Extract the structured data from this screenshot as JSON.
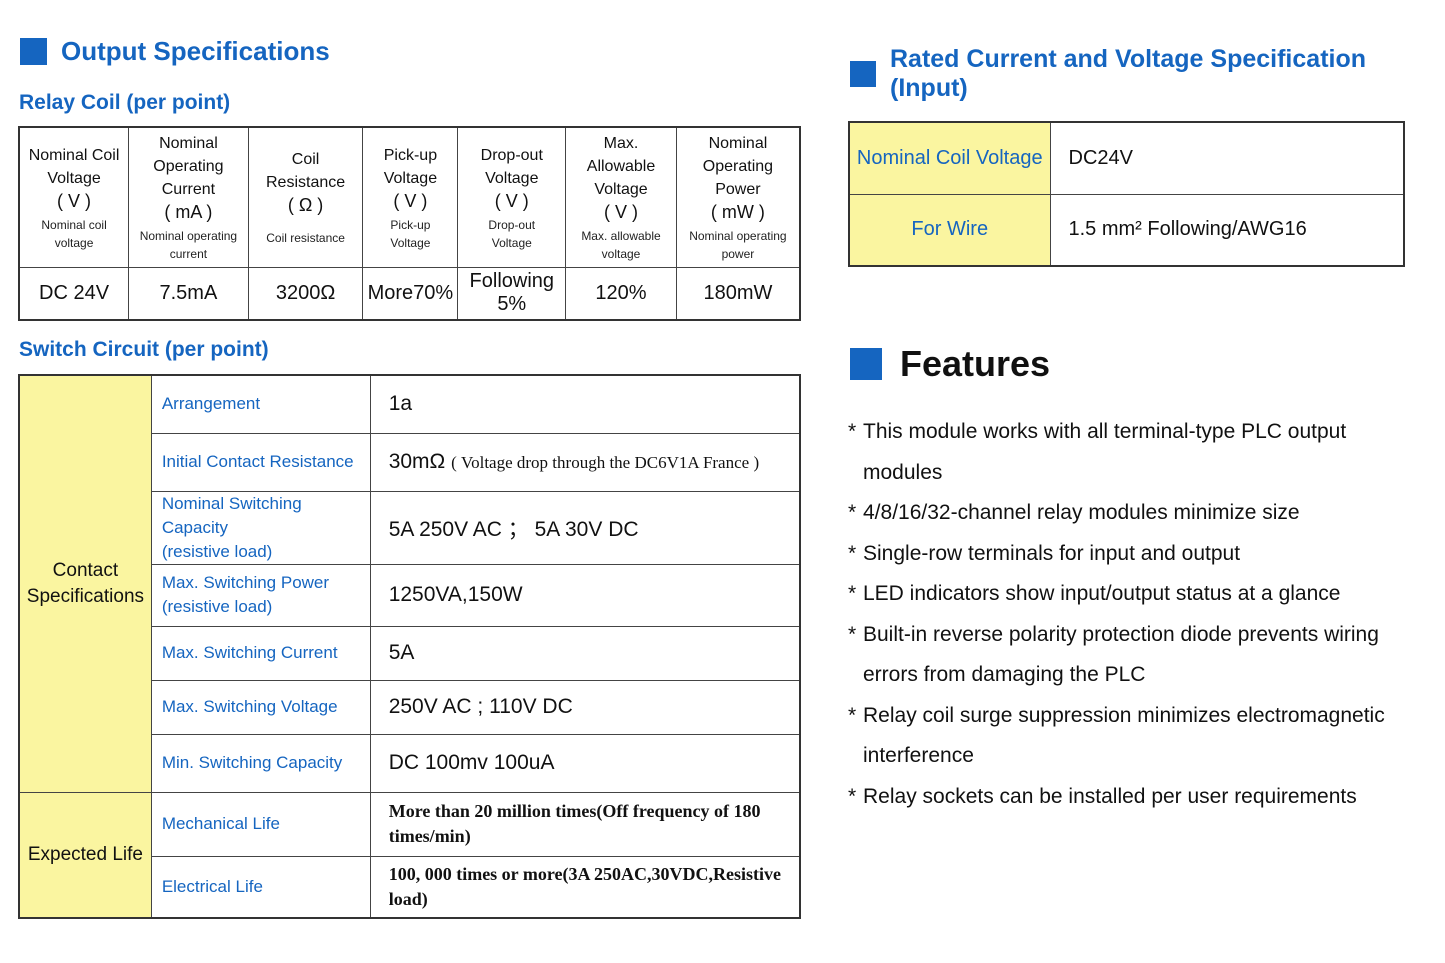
{
  "output_specs": {
    "title": "Output Specifications"
  },
  "relay_coil": {
    "title": "Relay Coil (per point)",
    "columns": [
      {
        "main1": "Nominal Coil",
        "main2": "Voltage",
        "unit": "( V )",
        "sub1": "Nominal coil",
        "sub2": "voltage",
        "value": "DC 24V"
      },
      {
        "main1": "Nominal Operating",
        "main2": "Current",
        "unit": "( mA )",
        "sub1": "Nominal operating",
        "sub2": "current",
        "value": "7.5mA"
      },
      {
        "main1": "Coil Resistance",
        "main2": "",
        "unit": "( Ω )",
        "sub1": "Coil resistance",
        "sub2": "",
        "value": "3200Ω"
      },
      {
        "main1": "Pick-up",
        "main2": "Voltage",
        "unit": "( V )",
        "sub1": "Pick-up",
        "sub2": "Voltage",
        "value": "More70%"
      },
      {
        "main1": "Drop-out",
        "main2": "Voltage",
        "unit": "( V )",
        "sub1": "Drop-out",
        "sub2": "Voltage",
        "value": "Following 5%"
      },
      {
        "main1": "Max. Allowable",
        "main2": "Voltage",
        "unit": "( V )",
        "sub1": "Max. allowable",
        "sub2": "voltage",
        "value": "120%"
      },
      {
        "main1": "Nominal Operating",
        "main2": "Power",
        "unit": "( mW )",
        "sub1": "Nominal operating",
        "sub2": "power",
        "value": "180mW"
      }
    ]
  },
  "switch_circuit": {
    "title": "Switch Circuit (per point)",
    "contact_label_1": "Contact",
    "contact_label_2": "Specifications",
    "life_label": "Expected Life",
    "rows": [
      {
        "param1": "Arrangement",
        "param2": "",
        "value": "1a"
      },
      {
        "param1": "Initial Contact Resistance",
        "param2": "",
        "value_main": "30mΩ",
        "value_note": "( Voltage drop through the DC6V1A France )"
      },
      {
        "param1": "Nominal Switching Capacity",
        "param2": "(resistive load)",
        "value": "5A 250V AC ； 5A 30V DC"
      },
      {
        "param1": "Max. Switching Power",
        "param2": "(resistive load)",
        "value": "1250VA,150W"
      },
      {
        "param1": "Max. Switching Current",
        "param2": "",
        "value": "5A"
      },
      {
        "param1": "Max. Switching Voltage",
        "param2": "",
        "value": "250V AC ; 110V DC"
      },
      {
        "param1": "Min. Switching Capacity",
        "param2": "",
        "value": "DC 100mv 100uA"
      },
      {
        "param1": "Mechanical Life",
        "param2": "",
        "value1": "More than 20 million times(Off frequency of 180",
        "value2": "times/min)"
      },
      {
        "param1": "Electrical Life",
        "param2": "",
        "value1": "100, 000 times or more(3A 250AC,30VDC,Resistive",
        "value2": "load)"
      }
    ]
  },
  "rated": {
    "title": "Rated Current and Voltage Specification (Input)",
    "rows": [
      {
        "label": "Nominal Coil Voltage",
        "value": "DC24V"
      },
      {
        "label": "For Wire",
        "value": "1.5 mm² Following/AWG16"
      }
    ]
  },
  "features": {
    "title": "Features",
    "items": [
      "This module works with all terminal-type PLC output modules",
      "4/8/16/32-channel relay modules minimize size",
      "Single-row terminals for input and output",
      "LED indicators show input/output status at a glance",
      "Built-in reverse polarity protection diode prevents wiring errors from damaging the PLC",
      "Relay coil surge suppression minimizes electromagnetic interference",
      "Relay sockets can be installed per user requirements"
    ],
    "bullet": "*"
  },
  "colors": {
    "accent": "#1565c0",
    "highlight": "#faf5a0"
  },
  "icons": {
    "section_marker": "square-bullet-icon"
  }
}
